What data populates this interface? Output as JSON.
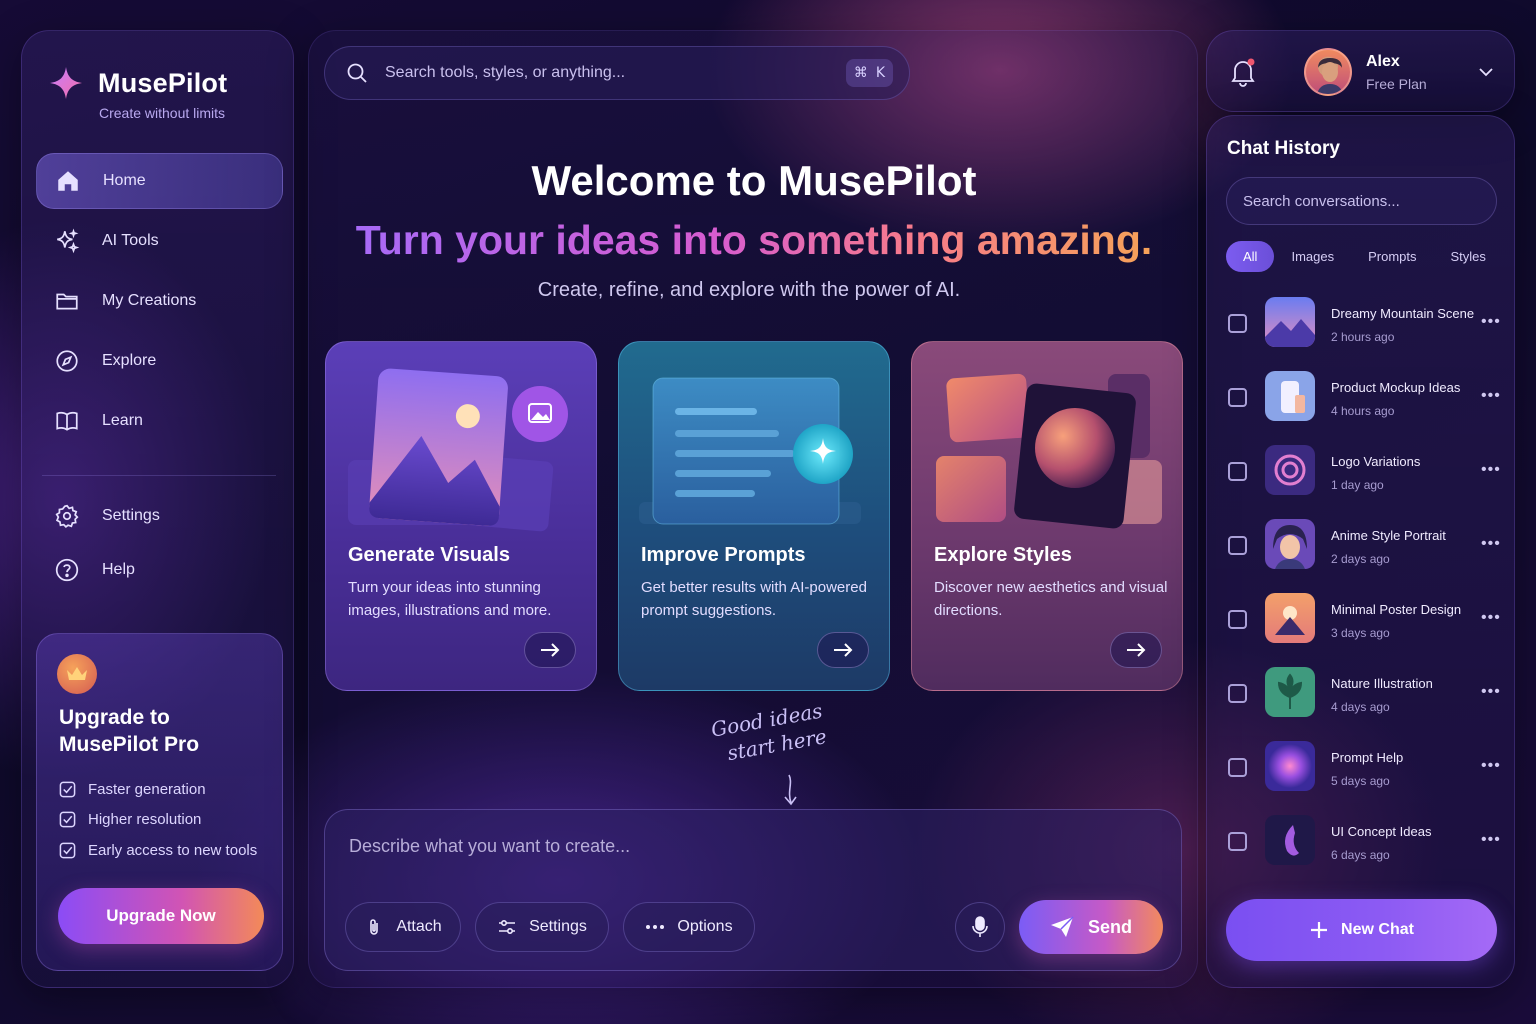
{
  "brand": {
    "name": "MusePilot",
    "tagline": "Create without limits"
  },
  "nav": [
    {
      "label": "Home",
      "icon": "home-icon",
      "active": true
    },
    {
      "label": "AI Tools",
      "icon": "sparkles-icon"
    },
    {
      "label": "My Creations",
      "icon": "folder-icon"
    },
    {
      "label": "Explore",
      "icon": "compass-icon"
    },
    {
      "label": "Learn",
      "icon": "book-icon"
    }
  ],
  "nav_secondary": [
    {
      "label": "Settings",
      "icon": "gear-icon"
    },
    {
      "label": "Help",
      "icon": "help-circle-icon"
    }
  ],
  "upgrade": {
    "title": "Upgrade to MusePilot Pro",
    "features": [
      "Faster generation",
      "Higher resolution",
      "Early access to new tools"
    ],
    "button": "Upgrade Now"
  },
  "search": {
    "placeholder": "Search tools, styles, or anything...",
    "shortcut_symbol": "⌘",
    "shortcut_key": "K"
  },
  "hero": {
    "title": "Welcome to MusePilot",
    "subtitle": "Turn your ideas into something amazing.",
    "description": "Create, refine, and explore with the power of AI."
  },
  "cards": [
    {
      "title": "Generate Visuals",
      "description": "Turn your ideas into stunning images, illustrations and more."
    },
    {
      "title": "Improve Prompts",
      "description": "Get better results with AI-powered prompt suggestions."
    },
    {
      "title": "Explore Styles",
      "description": "Discover new aesthetics and visual directions."
    }
  ],
  "note": {
    "line1": "Good ideas",
    "line2": "start here"
  },
  "composer": {
    "placeholder": "Describe what you want to create...",
    "attach": "Attach",
    "settings": "Settings",
    "options": "Options",
    "send": "Send"
  },
  "user": {
    "name": "Alex",
    "plan": "Free Plan"
  },
  "history": {
    "title": "Chat History",
    "search_placeholder": "Search conversations...",
    "filters": [
      "All",
      "Images",
      "Prompts",
      "Styles"
    ],
    "items": [
      {
        "name": "Dreamy Mountain Scene",
        "time": "2 hours ago"
      },
      {
        "name": "Product Mockup Ideas",
        "time": "4 hours ago"
      },
      {
        "name": "Logo Variations",
        "time": "1 day ago"
      },
      {
        "name": "Anime Style Portrait",
        "time": "2 days ago"
      },
      {
        "name": "Minimal Poster Design",
        "time": "3 days ago"
      },
      {
        "name": "Nature Illustration",
        "time": "4 days ago"
      },
      {
        "name": "Prompt Help",
        "time": "5 days ago"
      },
      {
        "name": "UI Concept Ideas",
        "time": "6 days ago"
      }
    ],
    "new_chat": "New Chat"
  },
  "colors": {
    "accent": "#7c5cf0",
    "brand_gradient_start": "#8b4cf6",
    "brand_gradient_end": "#f38a58"
  }
}
